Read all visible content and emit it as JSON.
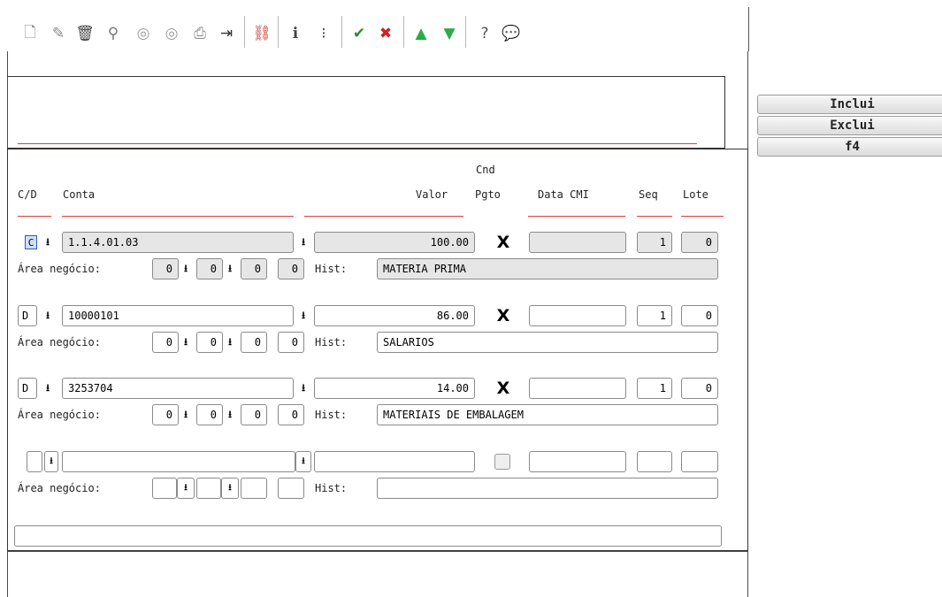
{
  "toolbar": {
    "icons": [
      "new-icon",
      "edit-icon",
      "delete-icon",
      "search-icon",
      "prev-icon",
      "next-icon",
      "print-icon",
      "exit-icon",
      "binoculars-icon",
      "info-icon",
      "list-icon",
      "confirm-icon",
      "cancel-icon",
      "up-icon",
      "down-icon",
      "help-icon",
      "comment-icon"
    ]
  },
  "buttons": {
    "inclui": "Inclui",
    "exclui": "Exclui",
    "f4": "f4"
  },
  "headers": {
    "cd": "C/D",
    "conta": "Conta",
    "valor": "Valor",
    "cnd": "Cnd",
    "pgto": "Pgto",
    "data_cmi": "Data CMI",
    "seq": "Seq",
    "lote": "Lote"
  },
  "labels": {
    "area_negocio": "Área negócio:",
    "hist": "Hist:"
  },
  "rows": [
    {
      "cd": "C",
      "conta": "1.1.4.01.03",
      "valor": "100.00",
      "pgto": "X",
      "data_cmi": "",
      "seq": "1",
      "lote": "0",
      "area": [
        "0",
        "0",
        "0",
        "0"
      ],
      "hist": "MATERIA PRIMA"
    },
    {
      "cd": "D",
      "conta": "10000101",
      "valor": "86.00",
      "pgto": "X",
      "data_cmi": "",
      "seq": "1",
      "lote": "0",
      "area": [
        "0",
        "0",
        "0",
        "0"
      ],
      "hist": "SALARIOS"
    },
    {
      "cd": "D",
      "conta": "3253704",
      "valor": "14.00",
      "pgto": "X",
      "data_cmi": "",
      "seq": "1",
      "lote": "0",
      "area": [
        "0",
        "0",
        "0",
        "0"
      ],
      "hist": "MATERIAIS DE EMBALAGEM"
    },
    {
      "cd": "",
      "conta": "",
      "valor": "",
      "pgto": "",
      "data_cmi": "",
      "seq": "",
      "lote": "",
      "area": [
        "",
        "",
        "",
        ""
      ],
      "hist": ""
    }
  ],
  "status_field": ""
}
